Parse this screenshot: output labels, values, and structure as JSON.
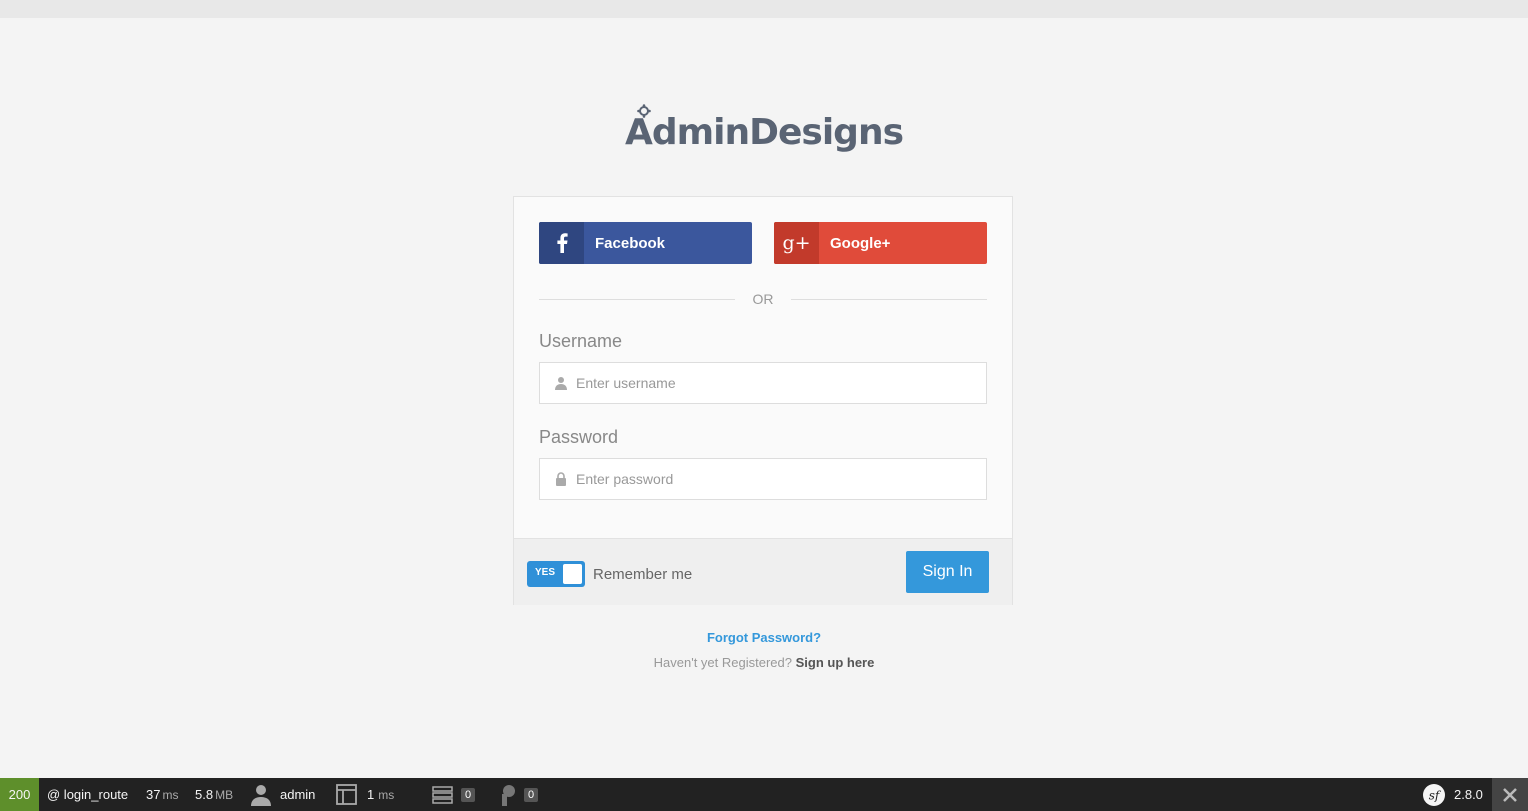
{
  "logo": {
    "first_letter": "A",
    "rest": "dminDesigns"
  },
  "social": {
    "facebook_label": "Facebook",
    "googleplus_label": "Google+",
    "googleplus_icon_text": "g+"
  },
  "divider": "OR",
  "form": {
    "username_label": "Username",
    "username_placeholder": "Enter username",
    "username_value": "",
    "password_label": "Password",
    "password_placeholder": "Enter password",
    "password_value": ""
  },
  "footer": {
    "toggle_label": "YES",
    "remember_label": "Remember me",
    "signin_label": "Sign In"
  },
  "links": {
    "forgot": "Forgot Password?",
    "not_registered": "Haven't yet Registered?",
    "signup": "Sign up here"
  },
  "toolbar": {
    "status_code": "200",
    "route": "@ login_route",
    "time_value": "37",
    "time_unit": "ms",
    "memory_value": "5.8",
    "memory_unit": "MB",
    "user": "admin",
    "twig_time": "1",
    "twig_unit": "ms",
    "db_count": "0",
    "events_count": "0",
    "version": "2.8.0"
  },
  "colors": {
    "facebook": "#3b579d",
    "googleplus": "#e04b3a",
    "primary": "#3498db",
    "status_ok": "#5e8f2b"
  }
}
